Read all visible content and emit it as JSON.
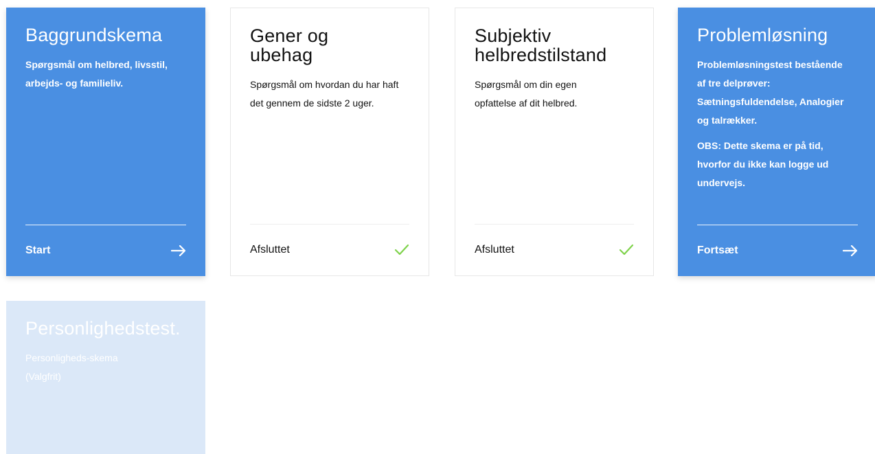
{
  "cards": [
    {
      "title": "Baggrundskema",
      "description": "Spørgsmål om helbred, livsstil, arbejds- og familieliv.",
      "footer_label": "Start",
      "footer_icon": "arrow-right-icon"
    },
    {
      "title": "Gener og ubehag",
      "description": "Spørgsmål om hvordan du har haft det gennem de sidste 2 uger.",
      "footer_label": "Afsluttet",
      "footer_icon": "checkmark-icon"
    },
    {
      "title": "Subjektiv helbredstilstand",
      "description": "Spørgsmål om din egen opfattelse af dit helbred.",
      "footer_label": "Afsluttet",
      "footer_icon": "checkmark-icon"
    },
    {
      "title": "Problemløsning",
      "description": "Problemløsningstest bestående af tre delprøver: Sætningsfuldendelse, Analogier og talrækker.",
      "note": "OBS: Dette skema er på tid, hvorfor du ikke kan logge ud undervejs.",
      "footer_label": "Fortsæt",
      "footer_icon": "arrow-right-icon"
    },
    {
      "title": "Personlighedstest.",
      "description": "Personligheds-skema (Valgfrit)"
    }
  ],
  "colors": {
    "accent": "#4a8fe2",
    "disabled": "#dbe8f8",
    "check": "#7ed24a"
  }
}
